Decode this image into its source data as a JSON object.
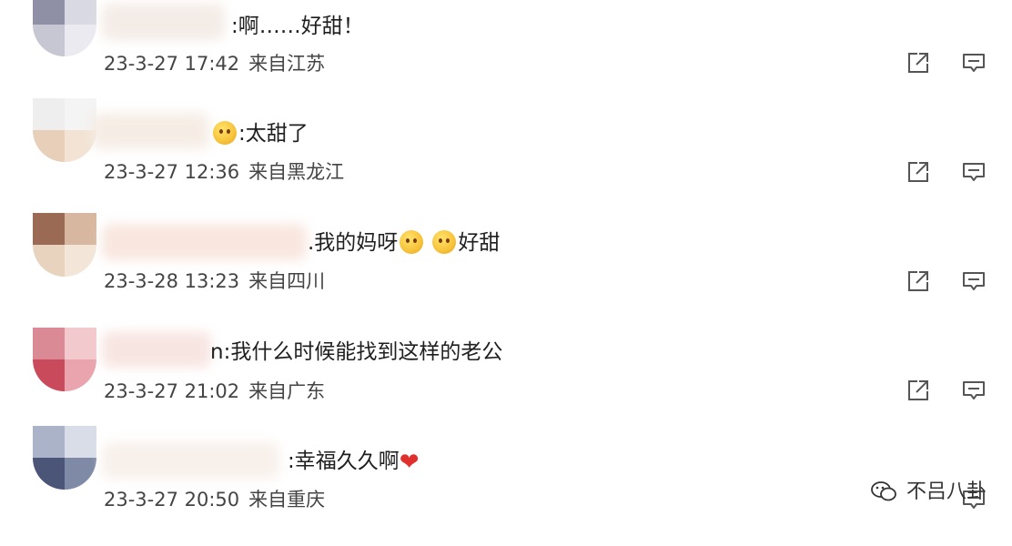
{
  "comments": [
    {
      "text": ":啊……好甜！",
      "timestamp": "23-3-27 17:42",
      "location": "来自江苏"
    },
    {
      "text": ":太甜了",
      "timestamp": "23-3-27 12:36",
      "location": "来自黑龙江"
    },
    {
      "text_a": ".我的妈呀",
      "text_b": "好甜",
      "timestamp": "23-3-28 13:23",
      "location": "来自四川"
    },
    {
      "text": "n:我什么时候能找到这样的老公",
      "timestamp": "23-3-27 21:02",
      "location": "来自广东"
    },
    {
      "text": ":幸福久久啊",
      "timestamp": "23-3-27 20:50",
      "location": "来自重庆"
    }
  ],
  "watermark": {
    "text": "不吕八卦"
  },
  "icons": {
    "share": "share-icon",
    "reply": "comment-icon",
    "emoji": "emoji-icon",
    "heart": "heart-icon"
  },
  "colors": {
    "text": "#1f1f1f",
    "meta": "#444444",
    "icon": "#555555",
    "heart": "#e0302e"
  }
}
